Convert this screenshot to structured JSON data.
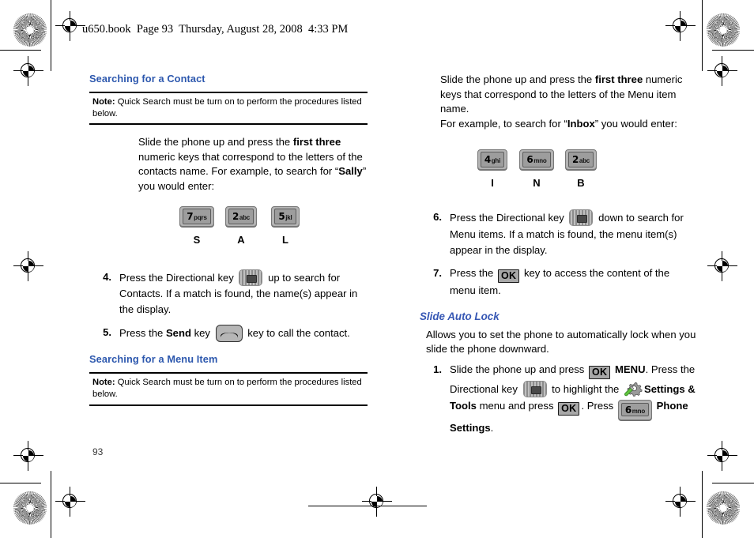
{
  "page_header": "u650.book  Page 93  Thursday, August 28, 2008  4:33 PM",
  "page_number": "93",
  "colors": {
    "heading_blue": "#2d58ae",
    "subheading_blue": "#3657b4",
    "key_gray": "#b3b3b3",
    "text_black": "#000000"
  },
  "left_column": {
    "heading": "Searching for a Contact",
    "note": {
      "label": "Note:",
      "text": "Quick Search must be turn on to perform the procedures listed below."
    },
    "intro": {
      "part1": "Slide the phone up and press the ",
      "bold1": "first three",
      "part2": " numeric keys that correspond to the letters of the contacts name. For example, to search for “",
      "bold2": "Sally",
      "part3": "” you would enter:"
    },
    "keys": [
      {
        "num": "7",
        "letters": "pqrs",
        "label": "S"
      },
      {
        "num": "2",
        "letters": "abc",
        "label": "A"
      },
      {
        "num": "5",
        "letters": "jkl",
        "label": "L"
      }
    ],
    "steps": [
      {
        "number": "4.",
        "part1": "Press the Directional key ",
        "icon": "directional-key-icon",
        "part2": " up to search for Contacts. If a match is found, the name(s) appear in the display."
      },
      {
        "number": "5.",
        "part1": "Press the ",
        "bold1": "Send",
        "part2": " key ",
        "icon": "send-key-icon",
        "part3": " key to call the contact."
      }
    ],
    "heading2": "Searching for a Menu Item",
    "note2": {
      "label": "Note:",
      "text": "Quick Search must be turn on to perform the procedures listed below."
    }
  },
  "right_column": {
    "intro": {
      "part1": "Slide the phone up and press the ",
      "bold1": "first three",
      "part2": " numeric keys that correspond to the letters of the Menu item name.",
      "line2_part1": "For example, to search for “",
      "line2_bold": "Inbox",
      "line2_part2": "” you would enter:"
    },
    "keys": [
      {
        "num": "4",
        "letters": "ghi",
        "label": "I"
      },
      {
        "num": "6",
        "letters": "mno",
        "label": "N"
      },
      {
        "num": "2",
        "letters": "abc",
        "label": "B"
      }
    ],
    "steps": [
      {
        "number": "6.",
        "part1": "Press the Directional key ",
        "icon": "directional-key-icon",
        "part2": " down to search for Menu items. If a match is found, the menu item(s) appear in the display."
      },
      {
        "number": "7.",
        "part1": "Press the ",
        "ok": "OK",
        "part2": " key to access the content of the menu item."
      }
    ],
    "section": {
      "heading": "Slide Auto Lock",
      "description": "Allows you to set the phone to automatically lock when you slide the phone downward.",
      "step": {
        "number": "1.",
        "part1": "Slide the phone up and press ",
        "ok1": "OK",
        "bold1": "MENU",
        "part2": ". Press the Directional key ",
        "icon1": "directional-key-icon",
        "part3": " to highlight the ",
        "icon2": "settings-tools-icon",
        "bold2": "Settings & Tools",
        "part4": " menu and press ",
        "ok2": "OK",
        "part5": ". Press ",
        "key6": {
          "num": "6",
          "letters": "mno"
        },
        "bold3": "Phone Settings",
        "part6": "."
      }
    }
  }
}
